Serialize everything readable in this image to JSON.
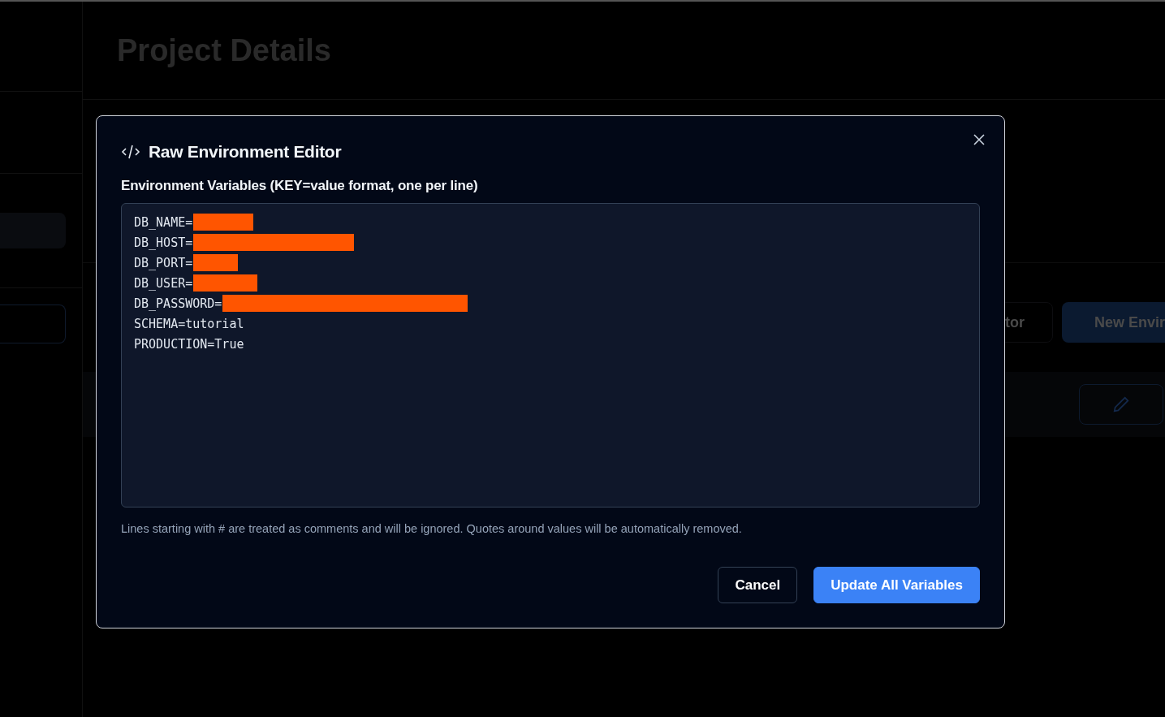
{
  "page": {
    "title": "Project Details",
    "actions": [
      "tor",
      "New Envir"
    ]
  },
  "dialog": {
    "title": "Raw Environment Editor",
    "field_label": "Environment Variables (KEY=value format, one per line)",
    "lines": [
      {
        "text": "DB_NAME=",
        "redacted": true
      },
      {
        "text": "DB_HOST=",
        "redacted": true
      },
      {
        "text": "DB_PORT=",
        "redacted": true
      },
      {
        "text": "DB_USER=",
        "redacted": true
      },
      {
        "text": "DB_PASSWORD=",
        "redacted": true
      },
      {
        "text": "SCHEMA=tutorial",
        "redacted": false
      },
      {
        "text": "PRODUCTION=True",
        "redacted": false
      }
    ],
    "hint": "Lines starting with # are treated as comments and will be ignored. Quotes around values will be automatically removed.",
    "buttons": [
      {
        "label": "Cancel",
        "kind": "secondary"
      },
      {
        "label": "Update All Variables",
        "kind": "primary"
      }
    ]
  }
}
